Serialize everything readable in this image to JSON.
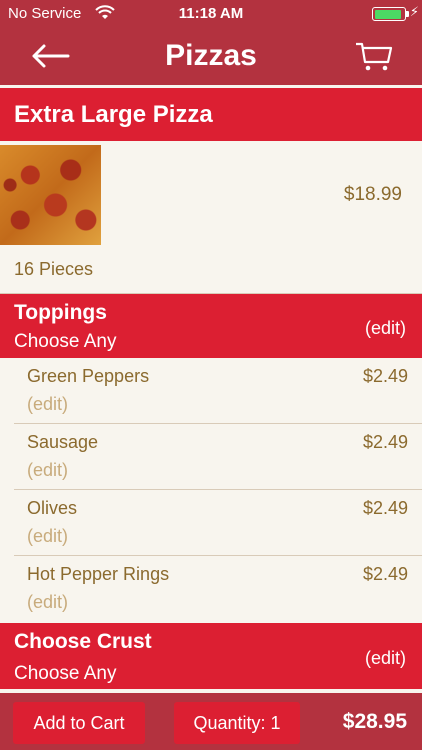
{
  "status_bar": {
    "carrier": "No Service",
    "time": "11:18 AM",
    "battery_level": 0.9
  },
  "nav": {
    "title": "Pizzas"
  },
  "product": {
    "name": "Extra Large Pizza",
    "price": "$18.99",
    "pieces": "16 Pieces"
  },
  "toppings_section": {
    "label": "Toppings",
    "sub": "Choose Any",
    "edit": "(edit)",
    "items": [
      {
        "name": "Green Peppers",
        "price": "$2.49",
        "edit": "(edit)"
      },
      {
        "name": "Sausage",
        "price": "$2.49",
        "edit": "(edit)"
      },
      {
        "name": "Olives",
        "price": "$2.49",
        "edit": "(edit)"
      },
      {
        "name": "Hot Pepper Rings",
        "price": "$2.49",
        "edit": "(edit)"
      }
    ]
  },
  "crust_section": {
    "label": "Choose Crust",
    "sub": "Choose Any",
    "edit": "(edit)"
  },
  "bottom_bar": {
    "add_to_cart": "Add to Cart",
    "quantity": "Quantity: 1",
    "total": "$28.95"
  },
  "colors": {
    "bar_red": "#b3323f",
    "accent_red": "#dc1f32",
    "cream": "#f8f5ee",
    "brown_text": "#8b6a2e",
    "light_brown_text": "#c8ab7c",
    "battery_green": "#4cd964"
  }
}
